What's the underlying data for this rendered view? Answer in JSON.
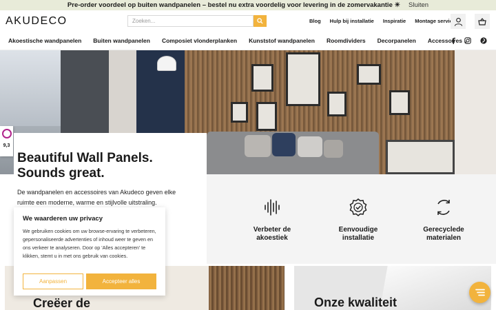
{
  "promo": {
    "text": "Pre-order voordeel op buiten wandpanelen – bestel nu extra voordelig voor levering in de zomervakantie ☀",
    "close": "Sluiten"
  },
  "header": {
    "logo": "AKUDECO",
    "search": {
      "placeholder": "Zoeken..."
    },
    "links": [
      "Blog",
      "Hulp bij installatie",
      "Inspiratie",
      "Montage service"
    ]
  },
  "nav": {
    "items": [
      "Akoestische wandpanelen",
      "Buiten wandpanelen",
      "Composiet vlonderplanken",
      "Kunststof wandpanelen",
      "Roomdividers",
      "Decorpanelen",
      "Accessoires"
    ],
    "social": [
      "facebook-icon",
      "instagram-icon",
      "pinterest-icon"
    ]
  },
  "rating": {
    "score": "9,3"
  },
  "hero": {
    "title_line1": "Beautiful Wall Panels.",
    "title_line2": "Sounds great.",
    "text": "De wandpanelen en accessoires van Akudeco geven elke ruimte een moderne, warme en stijlvolle uitstraling."
  },
  "features": [
    {
      "icon": "soundwave-icon",
      "line1": "Verbeter de",
      "line2": "akoestiek"
    },
    {
      "icon": "badge-check-icon",
      "line1": "Eenvoudige",
      "line2": "installatie"
    },
    {
      "icon": "recycle-icon",
      "line1": "Gerecyclede",
      "line2": "materialen"
    }
  ],
  "sections": {
    "left_title": "Creëer de",
    "right_title": "Onze kwaliteit"
  },
  "cookie": {
    "title": "We waarderen uw privacy",
    "text": "We gebruiken cookies om uw browse-ervaring te verbeteren, gepersonaliseerde advertenties of inhoud weer te geven en ons verkeer te analyseren. Door op 'Alles accepteren' te klikken, stemt u in met ons gebruik van cookies.",
    "customize": "Aanpassen",
    "accept": "Accepteer alles"
  },
  "colors": {
    "accent": "#f2b33d",
    "promo_bg": "#e8ebd9",
    "rating_brand": "#b0238b"
  }
}
